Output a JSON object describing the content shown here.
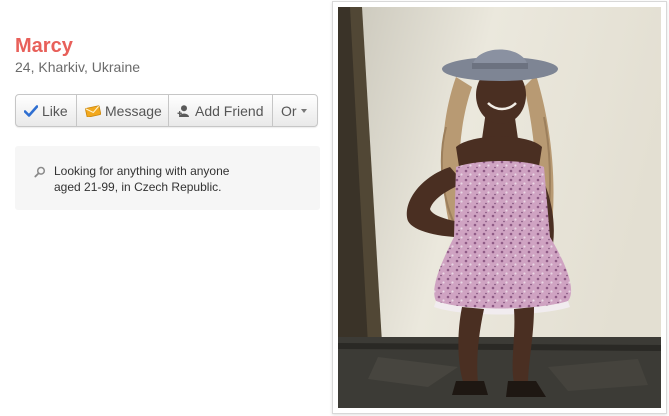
{
  "profile": {
    "name": "Marcy",
    "meta": "24, Kharkiv, Ukraine"
  },
  "actions": {
    "like": "Like",
    "message": "Message",
    "add_friend": "Add Friend",
    "or": "Or"
  },
  "search": {
    "line1": "Looking for anything with anyone",
    "line2": "aged 21-99, in Czech Republic."
  },
  "colors": {
    "name": "#e8605a",
    "like_check": "#2f6fd1",
    "message_envelope": "#f2a81d"
  },
  "icons": {
    "like": "check-icon",
    "message": "envelope-icon",
    "add_friend": "person-add-icon",
    "or": "chevron-down-icon",
    "search": "magnifier-icon"
  }
}
